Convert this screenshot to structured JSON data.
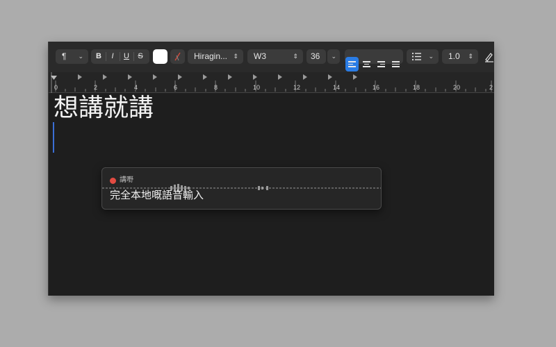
{
  "toolbar": {
    "paragraph_style_icon": "paragraph-icon",
    "bold_label": "B",
    "italic_label": "I",
    "underline_label": "U",
    "strike_label": "S",
    "font_family": "Hiragin...",
    "font_weight": "W3",
    "font_size": "36",
    "line_spacing": "1.0",
    "colors": {
      "text_swatch": "#ffffff",
      "active_align": "#2a7ce5"
    }
  },
  "ruler": {
    "labels": [
      "0",
      "2",
      "4",
      "6",
      "8",
      "10",
      "12",
      "14",
      "16",
      "18",
      "20",
      "2"
    ]
  },
  "document": {
    "text": "想講就講"
  },
  "dictation": {
    "title": "講嘢",
    "transcript": "完全本地嘅語音輸入",
    "status_color": "#e34b42"
  }
}
